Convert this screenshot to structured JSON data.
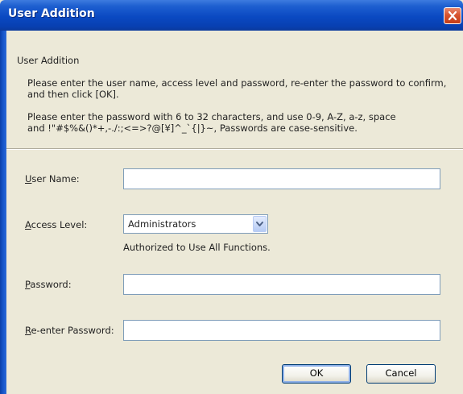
{
  "window": {
    "title": "User Addition",
    "close_icon": "close-icon"
  },
  "header": {
    "heading": "User Addition",
    "instructions_line1": "Please enter the user name, access level and password, re-enter the password to confirm,",
    "instructions_line2": "and then click [OK].",
    "password_rules_line1": "Please enter the password with 6 to 32 characters, and use 0-9, A-Z, a-z, space",
    "password_rules_line2": "and !\"#$%&()*+,-./:;<=>?@[¥]^_`{|}~, Passwords are case-sensitive."
  },
  "form": {
    "user_name": {
      "mnemonic": "U",
      "label_rest": "ser Name:",
      "value": ""
    },
    "access_level": {
      "mnemonic": "A",
      "label_rest": "ccess Level:",
      "selected": "Administrators",
      "description": "Authorized to Use All Functions.",
      "arrow_icon": "chevron-down-icon"
    },
    "password": {
      "mnemonic": "P",
      "label_rest": "assword:",
      "value": ""
    },
    "reenter_password": {
      "mnemonic": "R",
      "label_rest": "e-enter Password:",
      "value": ""
    }
  },
  "buttons": {
    "ok_label": "OK",
    "cancel_label": "Cancel"
  },
  "colors": {
    "titlebar": "#0a49c2",
    "dialog_background": "#ece9d8",
    "close_button": "#d8542f",
    "input_border": "#7f9db9"
  }
}
